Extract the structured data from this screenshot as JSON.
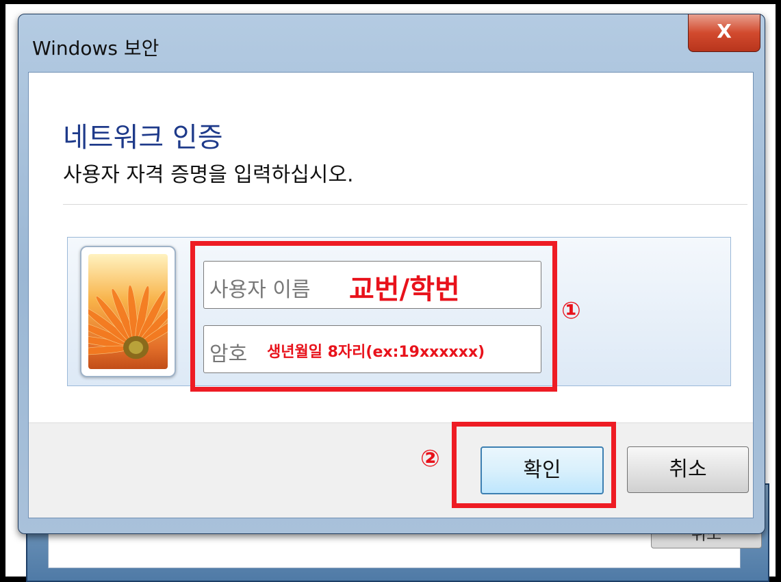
{
  "window": {
    "title": "Windows 보안",
    "close_label": "X"
  },
  "content": {
    "heading": "네트워크 인증",
    "subheading": "사용자 자격 증명을 입력하십시오."
  },
  "credentials": {
    "username_label": "사용자 이름",
    "username_annotation": "교번/학번",
    "password_label": "암호",
    "password_annotation": "생년월일 8자리(ex:19xxxxxx)"
  },
  "buttons": {
    "ok": "확인",
    "cancel": "취소"
  },
  "annotations": {
    "step1": "①",
    "step2": "②"
  },
  "background_window": {
    "button_label": "취소"
  },
  "colors": {
    "annotation_red": "#ee1c24",
    "heading_blue": "#1e3a8a"
  }
}
